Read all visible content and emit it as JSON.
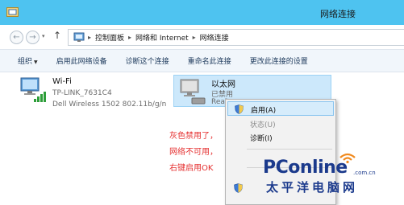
{
  "window": {
    "title": "网络连接"
  },
  "address_bar": {
    "back": "←",
    "forward": "→",
    "history": "▾",
    "up": "↑",
    "breadcrumbs": [
      "控制面板",
      "网络和 Internet",
      "网络连接"
    ]
  },
  "toolbar": {
    "items": [
      {
        "label": "组织",
        "has_arrow": true
      },
      {
        "label": "启用此网络设备"
      },
      {
        "label": "诊断这个连接"
      },
      {
        "label": "重命名此连接"
      },
      {
        "label": "更改此连接的设置"
      }
    ]
  },
  "adapters": {
    "wifi": {
      "name": "Wi-Fi",
      "status": "TP-LINK_7631C4",
      "device": "Dell Wireless 1502 802.11b/g/n"
    },
    "ethernet": {
      "name": "以太网",
      "status": "已禁用",
      "device": "Realt"
    }
  },
  "context_menu": {
    "items": [
      {
        "label": "启用(A)",
        "state": "hover",
        "shield": true
      },
      {
        "label": "状态(U)",
        "state": "disabled"
      },
      {
        "label": "诊断(I)",
        "state": "normal"
      }
    ]
  },
  "annotation": {
    "lines": [
      "灰色禁用了，",
      "网络不可用，",
      "右键启用OK"
    ]
  },
  "watermark": {
    "logo": "PConline",
    "domain": ".com.cn",
    "chinese": "太平洋电脑网"
  },
  "colors": {
    "titlebar": "#4ec3f0",
    "selection": "#cce8fb",
    "annotation": "#e53030",
    "watermark": "#1b3a8c"
  }
}
